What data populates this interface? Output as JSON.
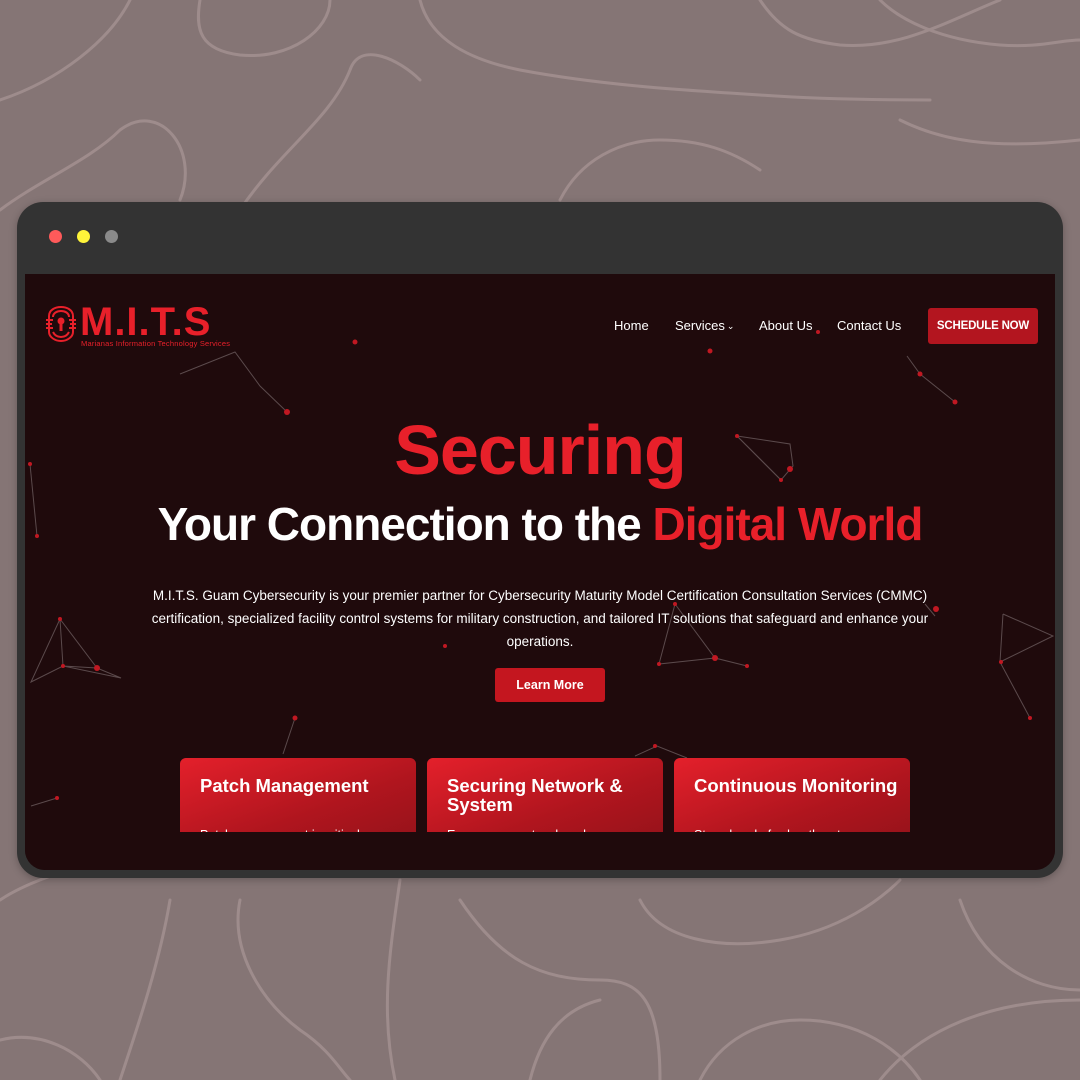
{
  "window": {
    "controls": [
      "close",
      "minimize",
      "zoom"
    ]
  },
  "site": {
    "logo_text": "M.I.T.S",
    "logo_subtitle": "Marianas Information Technology Services"
  },
  "nav": {
    "items": [
      {
        "label": "Home"
      },
      {
        "label": "Services"
      },
      {
        "label": "About Us"
      },
      {
        "label": "Contact Us"
      }
    ],
    "cta_label": "SCHEDULE NOW"
  },
  "hero": {
    "title_line1": "Securing",
    "title_line2_white": "Your Connection to the ",
    "title_line2_red": "Digital World",
    "description": "M.I.T.S. Guam Cybersecurity is your premier partner for Cybersecurity Maturity Model Certification Consultation Services (CMMC) certification, specialized facility control systems for military construction, and tailored IT solutions that safeguard and enhance your operations.",
    "button_label": "Learn More"
  },
  "cards": [
    {
      "title": "Patch Management",
      "text": "Patch management is critical"
    },
    {
      "title": "Securing Network & System",
      "text": "Ensure your network and"
    },
    {
      "title": "Continuous Monitoring",
      "text": "Stay ahead of cyber threats"
    }
  ],
  "colors": {
    "brand_red": "#e8202a",
    "page_bg": "#1f0a0c",
    "outer_bg": "#857575",
    "window_chrome": "#333333"
  }
}
